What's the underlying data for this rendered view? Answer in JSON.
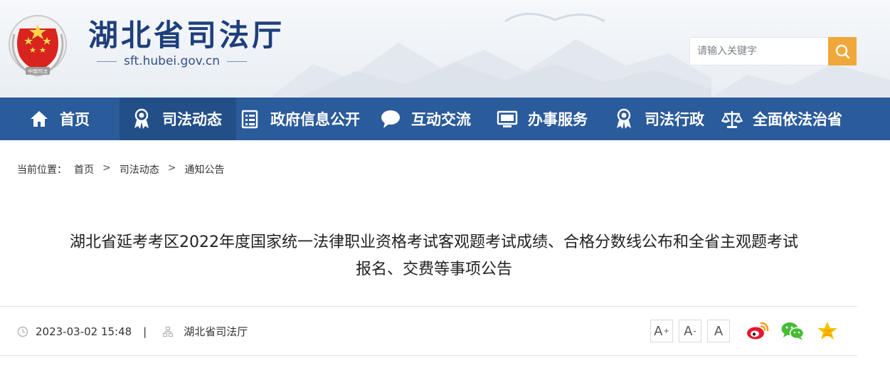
{
  "header": {
    "title": "湖北省司法厅",
    "domain": "sft.hubei.gov.cn",
    "emblem_text": "中国司法",
    "search": {
      "placeholder": "请输入关键字",
      "icon": "search-icon"
    }
  },
  "nav": {
    "items": [
      {
        "label": "首页",
        "icon": "home-icon"
      },
      {
        "label": "司法动态",
        "icon": "justice-badge-icon",
        "active": true
      },
      {
        "label": "政府信息公开",
        "icon": "document-list-icon"
      },
      {
        "label": "互动交流",
        "icon": "chat-bubble-icon"
      },
      {
        "label": "办事服务",
        "icon": "monitor-icon"
      },
      {
        "label": "司法行政",
        "icon": "justice-badge-icon"
      },
      {
        "label": "全面依法治省",
        "icon": "scales-icon"
      }
    ]
  },
  "breadcrumb": {
    "prefix": "当前位置：",
    "items": [
      "首页",
      "司法动态",
      "通知公告"
    ],
    "separator": ">"
  },
  "article": {
    "title_line1": "湖北省延考考区2022年度国家统一法律职业资格考试客观题考试成绩、合格分数线公布和全省主观题考试",
    "title_line2": "报名、交费等事项公告",
    "datetime": "2023-03-02 15:48",
    "separator": "|",
    "source": "湖北省司法厅"
  },
  "font_size_controls": [
    "A",
    "A",
    "A"
  ],
  "share": [
    "weibo-icon",
    "wechat-icon",
    "qzone-icon"
  ],
  "colors": {
    "nav_bg": "#2a5b9a",
    "nav_active": "#234f88",
    "title_blue": "#1f3f7a",
    "search_btn": "#f0a83a",
    "emblem_red": "#d8231f"
  }
}
